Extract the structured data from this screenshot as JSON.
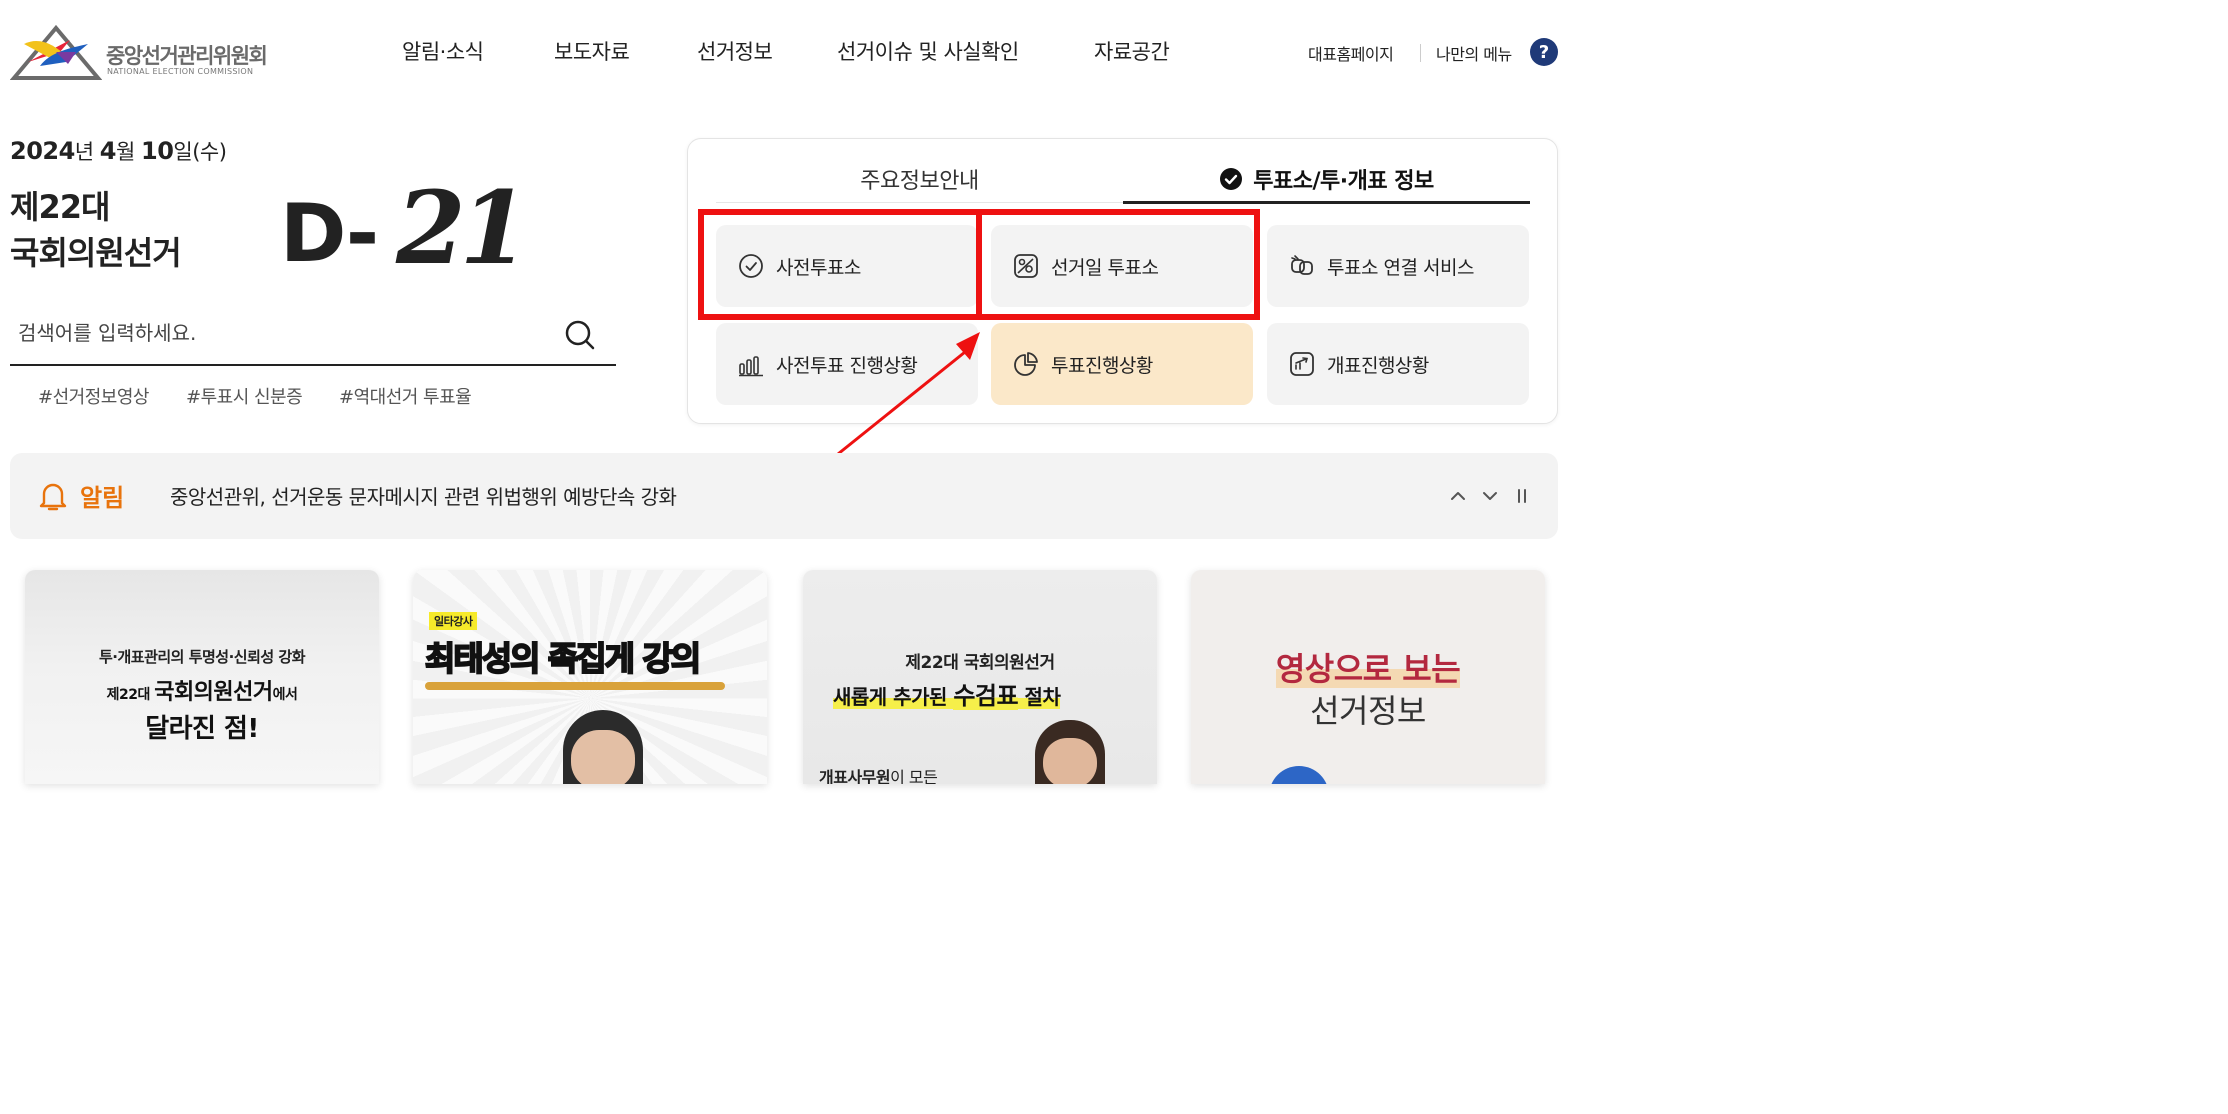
{
  "header": {
    "logo_ko": "중앙선거관리위원회",
    "logo_en": "NATIONAL ELECTION COMMISSION",
    "nav": [
      "알림·소식",
      "보도자료",
      "선거정보",
      "선거이슈 및 사실확인",
      "자료공간"
    ],
    "util_home": "대표홈페이지",
    "util_menu": "나만의 메뉴",
    "help_glyph": "?"
  },
  "hero": {
    "date_year": "2024",
    "date_y_unit": "년 ",
    "date_month": "4",
    "date_m_unit": "월 ",
    "date_day": "10",
    "date_d_unit": "일(수)",
    "election_line1": "제22대",
    "election_line2": "국회의원선거",
    "dday_label": "D-",
    "dday_number": "21"
  },
  "search": {
    "placeholder": "검색어를 입력하세요.",
    "value": "",
    "tags": [
      "#선거정보영상",
      "#투표시 신분증",
      "#역대선거 투표율"
    ]
  },
  "panel": {
    "tabs": [
      "주요정보안내",
      "투표소/투·개표 정보"
    ],
    "active_tab": 1,
    "services": [
      {
        "label": "사전투표소",
        "icon": "check-circle-icon"
      },
      {
        "label": "선거일 투표소",
        "icon": "map-image-icon"
      },
      {
        "label": "투표소 연결 서비스",
        "icon": "link-icon"
      },
      {
        "label": "사전투표 진행상황",
        "icon": "bar-chart-icon"
      },
      {
        "label": "투표진행상황",
        "icon": "pie-chart-icon"
      },
      {
        "label": "개표진행상황",
        "icon": "trend-up-icon"
      }
    ]
  },
  "notice": {
    "label": "알림",
    "text": "중앙선관위, 선거운동 문자메시지 관련 위법행위 예방단속 강화"
  },
  "cards": [
    {
      "line1": "투·개표관리의 투명성·신뢰성 강화",
      "line2_pre": "제22대 ",
      "line2_main": "국회의원선거",
      "line2_post": "에서",
      "line3": "달라진 점!"
    },
    {
      "badge": "일타강사",
      "title": "최태성의 족집게 강의"
    },
    {
      "line1": "제22대 국회의원선거",
      "line2_pre": "새롭게 추가된 ",
      "line2_main": "수검표",
      "line2_post": " 절차",
      "line3_pre": "개표사무원",
      "line3_post": "이 모든"
    },
    {
      "line1": "영상으로 보는",
      "line2": "선거정보"
    }
  ],
  "colors": {
    "accent_orange": "#e8730c",
    "highlight_bg": "#fbe8c9",
    "annotation_red": "#ee1111",
    "brand_navy": "#1f3a78"
  }
}
